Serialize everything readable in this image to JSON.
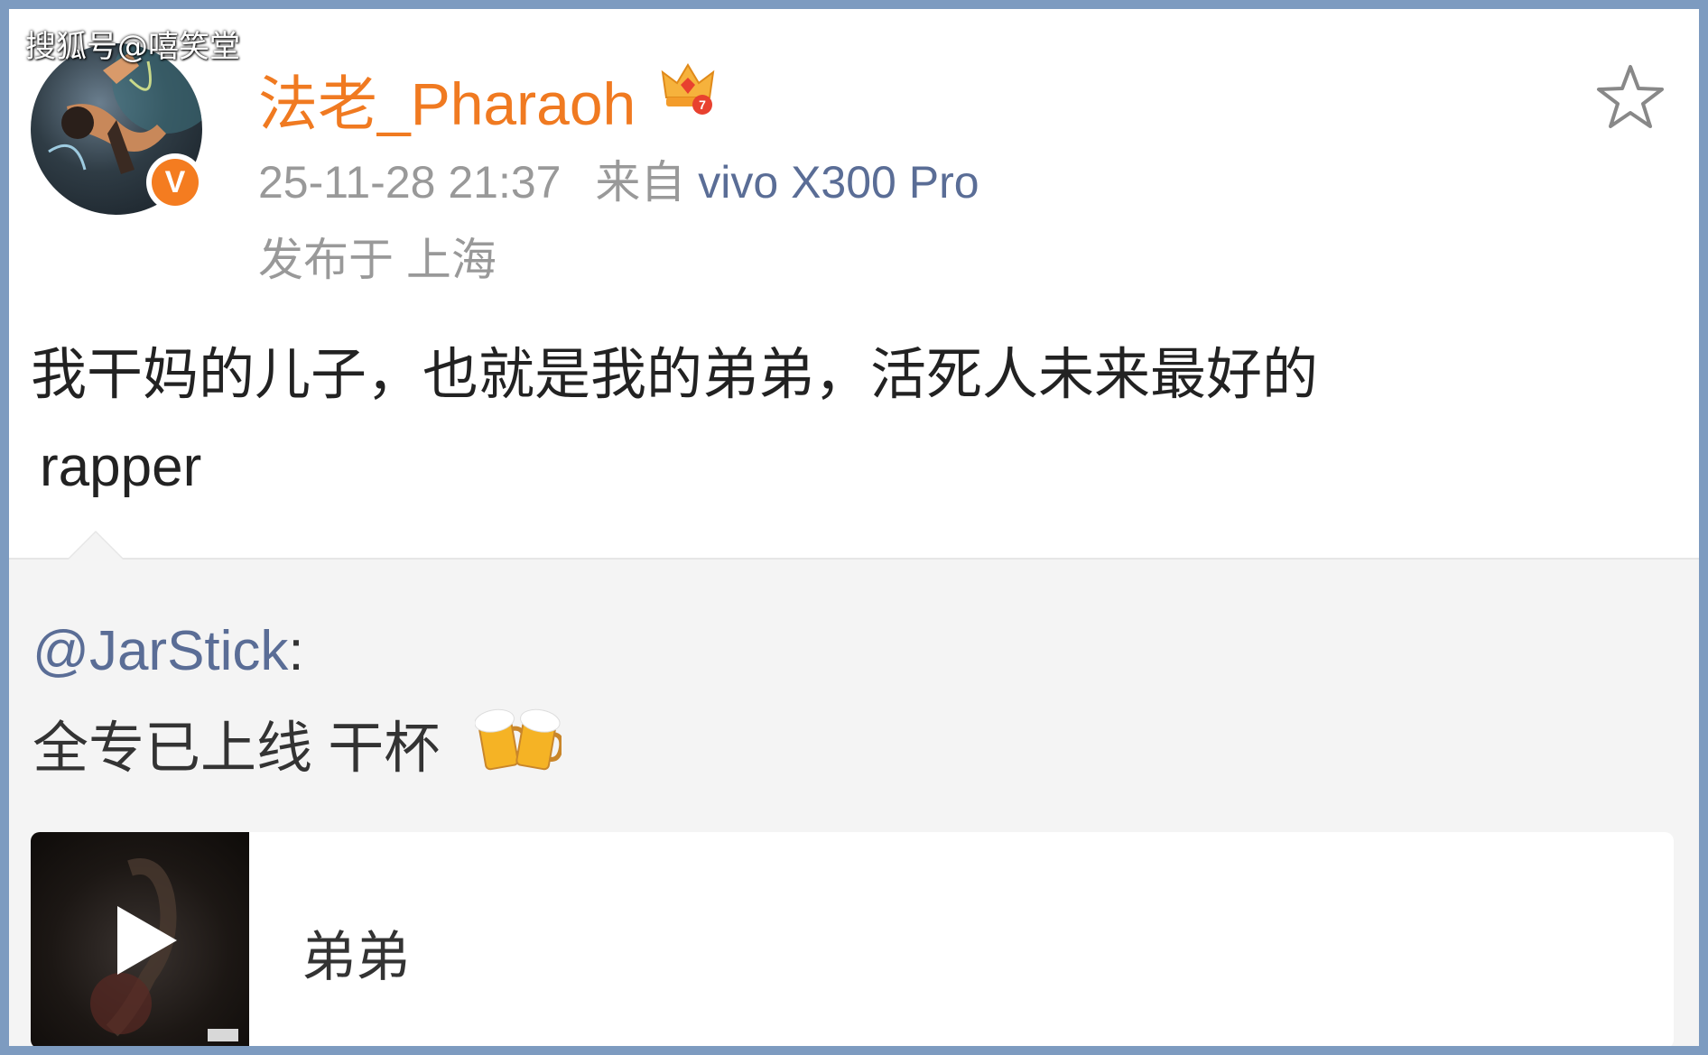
{
  "watermark": "搜狐号@嘻笑堂",
  "post": {
    "username": "法老_Pharaoh",
    "timestamp": "25-11-28 21:37",
    "source_prefix": "来自",
    "device": "vivo X300 Pro",
    "location": "发布于 上海",
    "text_line1": "我干妈的儿子，也就是我的弟弟，活死人未来最好的",
    "text_line2": "rapper"
  },
  "repost": {
    "user": "@JarStick",
    "colon": ":",
    "text": "全专已上线 干杯"
  },
  "music_card": {
    "title": "弟弟"
  },
  "icons": {
    "badge": "verified-v-icon",
    "crown": "crown-icon",
    "favorite": "star-icon",
    "emoji": "beer-mugs-icon",
    "play": "play-icon"
  },
  "colors": {
    "username": "#f07a21",
    "link": "#5a6d96",
    "meta": "#999999",
    "verified": "#f47c20"
  }
}
